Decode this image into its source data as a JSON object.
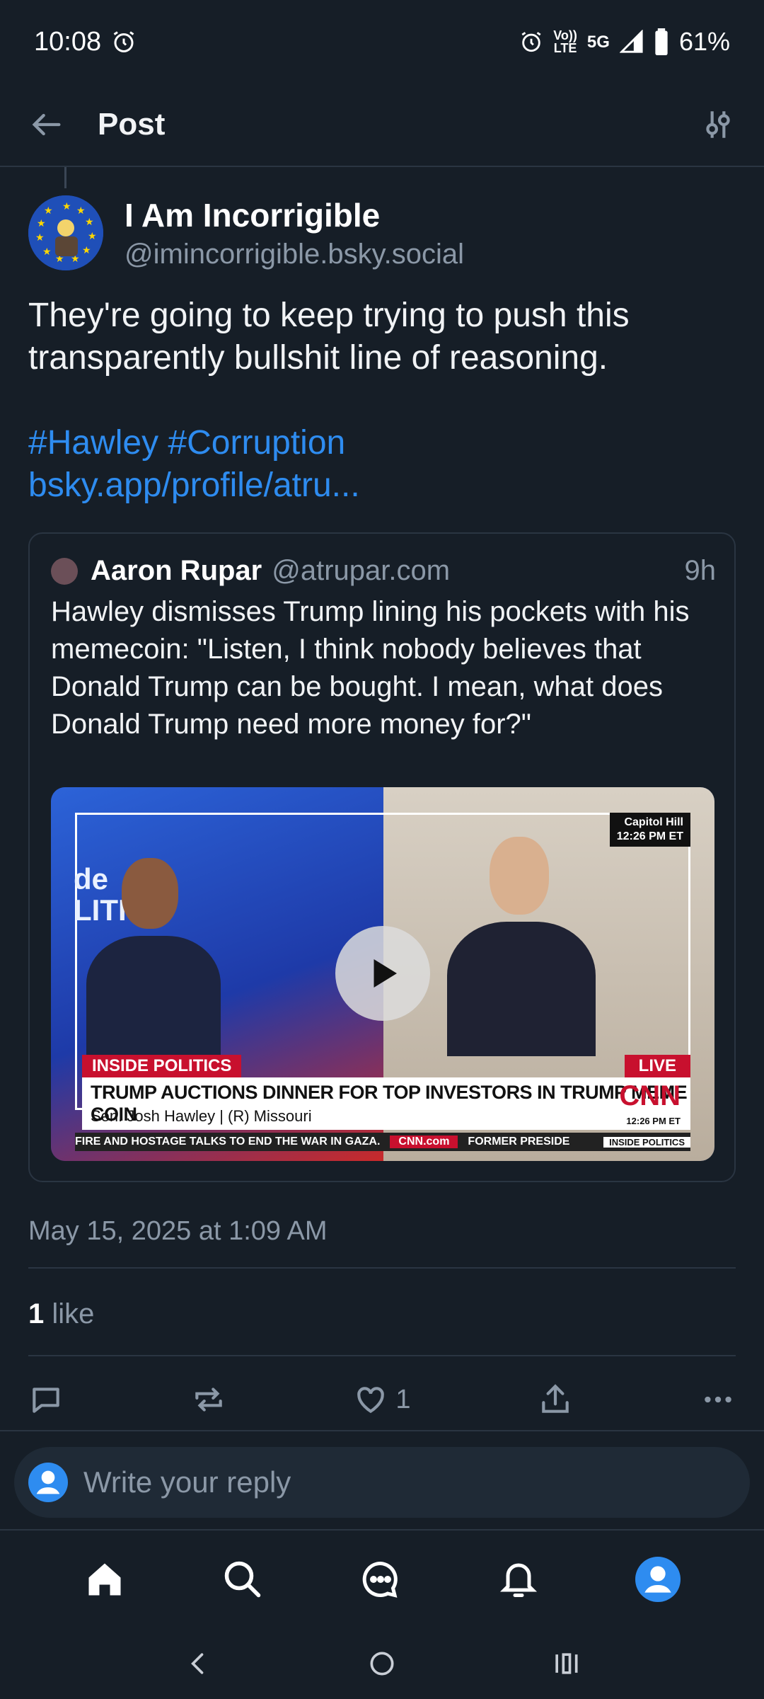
{
  "status_bar": {
    "time": "10:08",
    "network_top": "Vo))",
    "network_bottom": "LTE",
    "network_gen": "5G",
    "battery": "61%"
  },
  "header": {
    "title": "Post"
  },
  "post": {
    "author_name": "I Am Incorrigible",
    "author_handle": "@imincorrigible.bsky.social",
    "text": "They're going to keep trying to push this transparently bullshit line of reasoning.",
    "hashtags": "#Hawley #Corruption",
    "link": "bsky.app/profile/atru...",
    "date": "May 15, 2025 at 1:09 AM",
    "likes_count": "1",
    "likes_label": "like",
    "like_action_count": "1"
  },
  "quote": {
    "author_name": "Aaron Rupar",
    "author_handle": "@atrupar.com",
    "time": "9h",
    "text": "Hawley dismisses Trump lining his pockets with his memecoin: \"Listen, I think nobody believes that Donald Trump can be bought. I mean, what does Donald Trump need more money for?\"",
    "video": {
      "location": "Capitol Hill",
      "location_time": "12:26 PM ET",
      "backdrop_text_1": "de",
      "backdrop_text_2": "LITICS",
      "show_tag": "INSIDE POLITICS",
      "live_tag": "LIVE",
      "headline": "TRUMP AUCTIONS DINNER FOR TOP INVESTORS IN TRUMP MEME COIN",
      "guest": "Sen. Josh Hawley  |  (R) Missouri",
      "network": "CNN",
      "chyron_time": "12:26 PM ET",
      "ticker_left": "FIRE AND HOSTAGE TALKS TO END THE WAR IN GAZA.",
      "ticker_site": "CNN.com",
      "ticker_right": "FORMER PRESIDE",
      "ticker_show": "INSIDE POLITICS"
    }
  },
  "reply": {
    "placeholder": "Write your reply"
  },
  "colors": {
    "background": "#161e27",
    "accent": "#2e8cf0",
    "muted": "#8b98a7",
    "divider": "#2a3542"
  },
  "icons": {
    "back": "arrow-left-icon",
    "filter": "sliders-icon",
    "reply": "comment-icon",
    "repost": "repost-icon",
    "like": "heart-icon",
    "share": "share-icon",
    "more": "ellipsis-icon",
    "home": "home-icon",
    "search": "search-icon",
    "chat": "chat-icon",
    "notifications": "bell-icon",
    "profile": "profile-icon"
  }
}
